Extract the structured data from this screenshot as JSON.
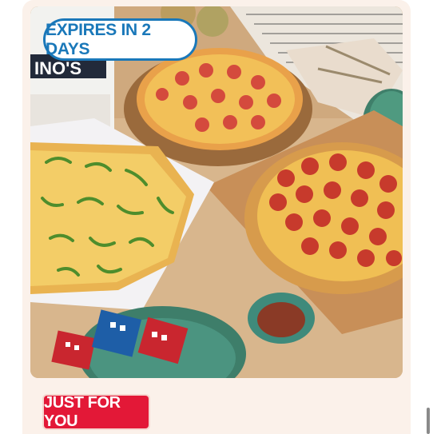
{
  "promo": {
    "expires_label": "EXPIRES IN 2 DAYS",
    "tag_label": "JUST FOR YOU",
    "image_alt": "Three Domino's pizzas on wooden boards with chili flakes and parmesan packets"
  },
  "colors": {
    "card_bg": "#fbf1ea",
    "expires_blue": "#1a78b9",
    "tag_red": "#e31837"
  }
}
